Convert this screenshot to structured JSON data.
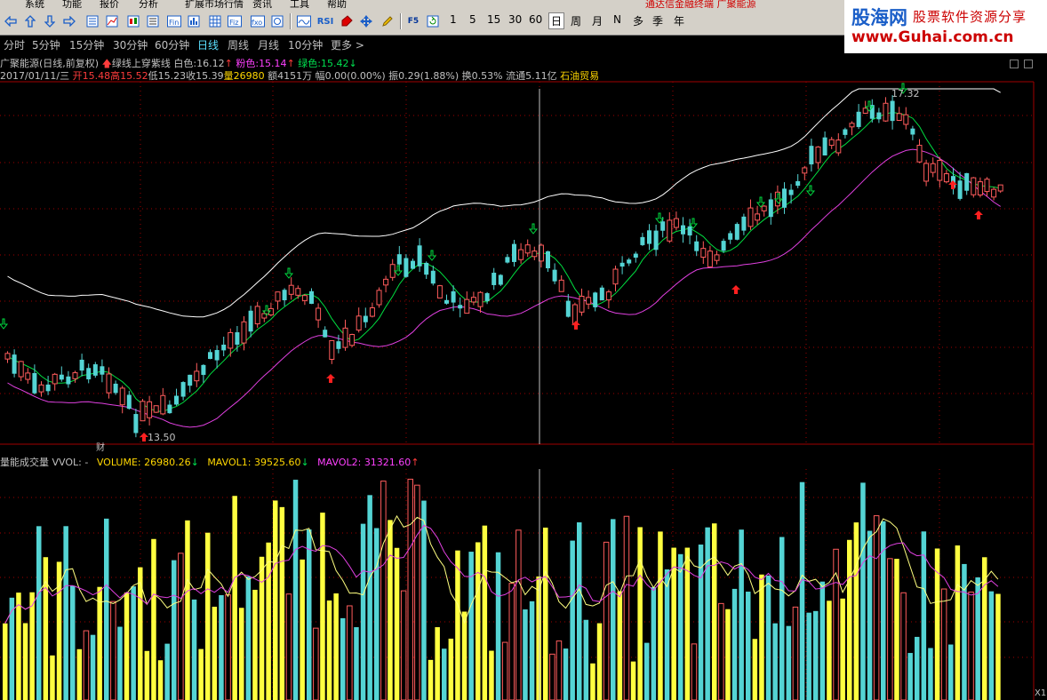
{
  "menu": {
    "items": [
      "系统",
      "功能",
      "报价",
      "分析",
      "扩展市场行情",
      "资讯",
      "工具",
      "帮助"
    ],
    "title": "通达信金融终端 广聚能源"
  },
  "toolbar": {
    "nums": [
      "1",
      "5",
      "15",
      "30",
      "60"
    ],
    "periods": [
      "日",
      "周",
      "月",
      "N",
      "多",
      "季",
      "年"
    ],
    "rsi_label": "RSI",
    "f5_label": "F5"
  },
  "logo": {
    "name": "股海网",
    "slogan": "股票软件资源分享",
    "url": "www.Guhai.com.cn"
  },
  "periodbar": {
    "items": [
      "分时",
      "5分钟",
      "15分钟",
      "30分钟",
      "60分钟",
      "日线",
      "周线",
      "月线",
      "10分钟",
      "更多 >"
    ],
    "selected": "日线"
  },
  "indicator": {
    "stock": "广聚能源(日线,前复权)",
    "formula": "绿线上穿紫线",
    "white_label": "白色:",
    "white_val": "16.12",
    "pink_label": "粉色:",
    "pink_val": "15.14",
    "green_label": "绿色:",
    "green_val": "15.42"
  },
  "quote": {
    "date": "2017/01/11/三",
    "open_label": "开",
    "open": "15.48",
    "high_label": "高",
    "high": "15.52",
    "low_label": "低",
    "low": "15.23",
    "close_label": "收",
    "close": "15.39",
    "vol_label": "量",
    "vol": "26980",
    "amt_label": "额",
    "amt": "4151万",
    "chg": "幅0.00(0.00%)",
    "amp": "振0.29(1.88%)",
    "turn": "换0.53%",
    "float": "流通5.11亿",
    "sector": "石油贸易"
  },
  "volume": {
    "name": "量能成交量",
    "formula": "VVOL: -",
    "v_label": "VOLUME: ",
    "v_val": "26980.26",
    "m1_label": "MAVOL1: ",
    "m1_val": "39525.60",
    "m2_label": "MAVOL2: ",
    "m2_val": "31321.60"
  },
  "annotations": {
    "high_label": "17.32",
    "low_label": "13.50",
    "cai": "财",
    "x1": "X1"
  },
  "colors": {
    "up": "#ff5c5c",
    "down": "#54d4d4",
    "white": "#ffffff",
    "pink": "#e040e0",
    "green": "#00dd40",
    "vol_yellow": "#ffff40",
    "grid": "#a00000"
  }
}
